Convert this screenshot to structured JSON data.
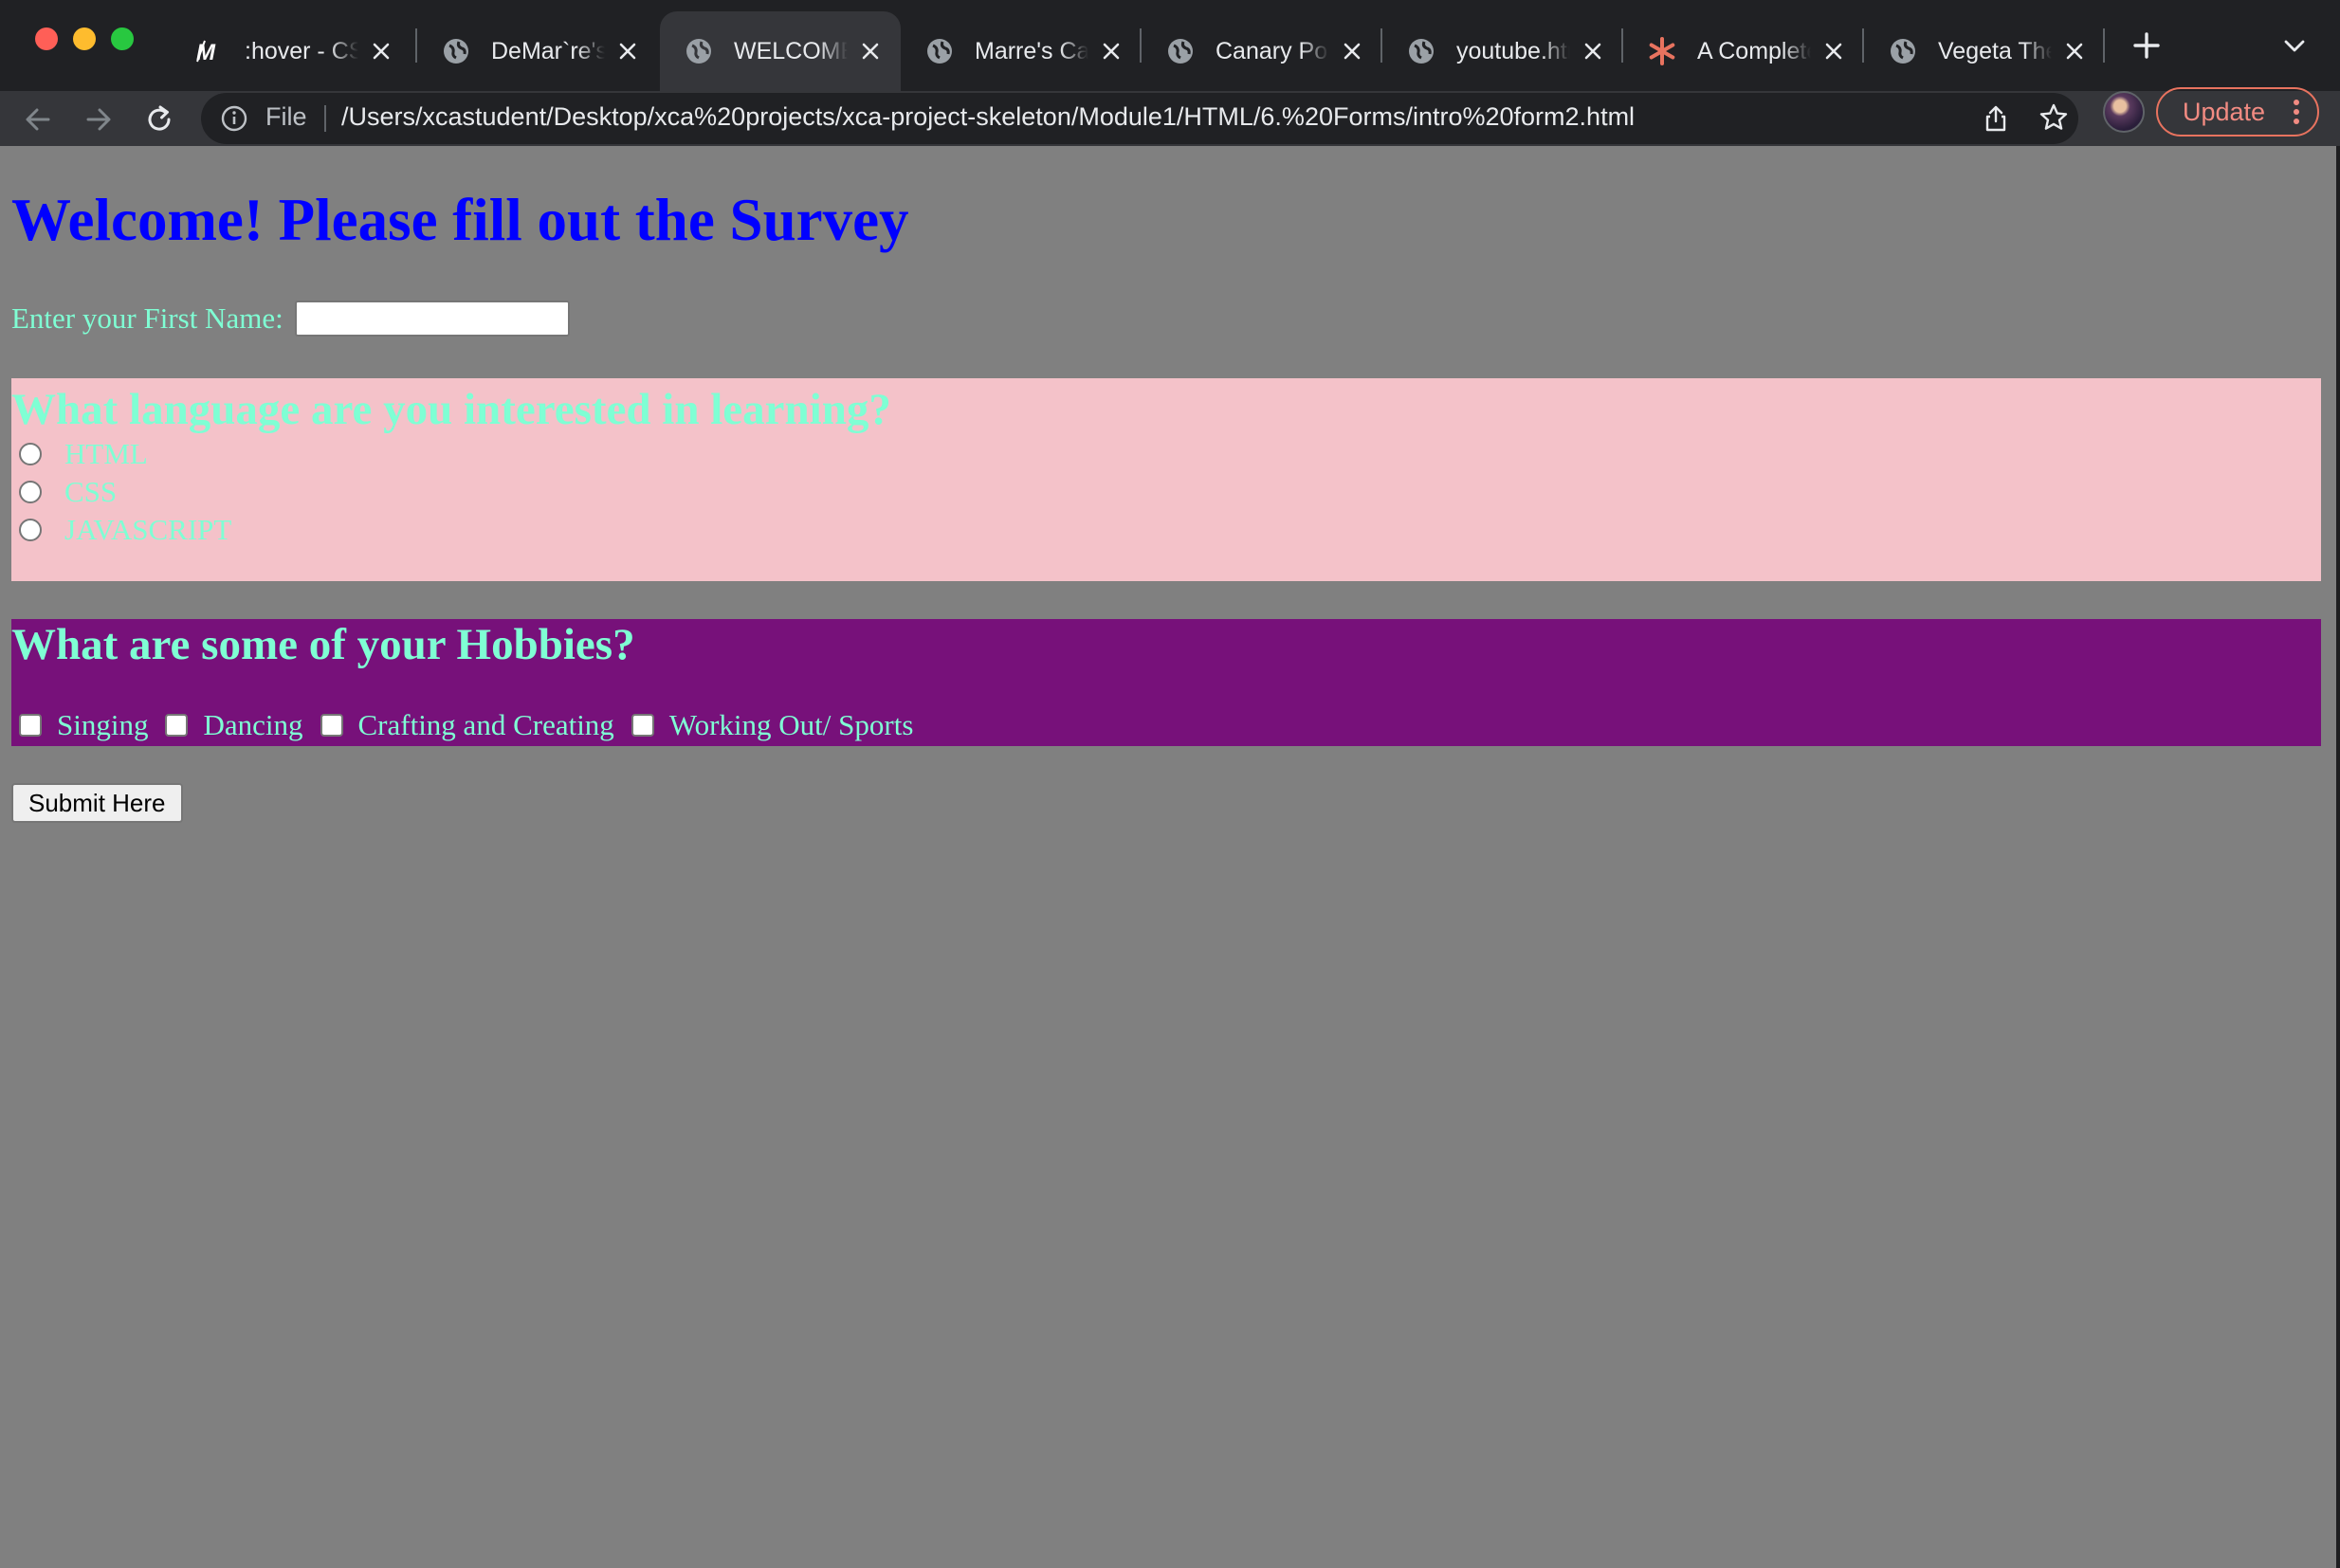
{
  "browser": {
    "tabs": [
      {
        "title": ":hover - CSS",
        "icon": "mdn-logo-icon",
        "active": false
      },
      {
        "title": "DeMar`re's Page",
        "icon": "globe-icon",
        "active": false
      },
      {
        "title": "WELCOME",
        "icon": "globe-icon",
        "active": true
      },
      {
        "title": "Marre's Cafe",
        "icon": "globe-icon",
        "active": false
      },
      {
        "title": "Canary Portfolio",
        "icon": "globe-icon",
        "active": false
      },
      {
        "title": "youtube.html",
        "icon": "globe-icon",
        "active": false
      },
      {
        "title": "A Complete Guide",
        "icon": "asterisk-icon",
        "active": false
      },
      {
        "title": "Vegeta The Prince",
        "icon": "globe-icon",
        "active": false
      }
    ],
    "address_bar": {
      "scheme_label": "File",
      "url": "/Users/xcastudent/Desktop/xca%20projects/xca-project-skeleton/Module1/HTML/6.%20Forms/intro%20form2.html"
    },
    "update_label": "Update",
    "accent_colors": {
      "update": "#f28b82",
      "asterisk": "#e8735f"
    }
  },
  "page": {
    "background": "#808080",
    "title": "Welcome! Please fill out the Survey",
    "first_name": {
      "label": "Enter your First Name:",
      "value": ""
    },
    "language_section": {
      "heading": "What language are you interested in learning?",
      "background": "#f4c2c9",
      "options": [
        "HTML",
        "CSS",
        "JAVASCRIPT"
      ]
    },
    "hobby_section": {
      "heading": "What are some of your Hobbies?",
      "background": "#77117a",
      "options": [
        "Singing",
        "Dancing",
        "Crafting and Creating",
        "Working Out/ Sports"
      ]
    },
    "submit_label": "Submit Here"
  }
}
